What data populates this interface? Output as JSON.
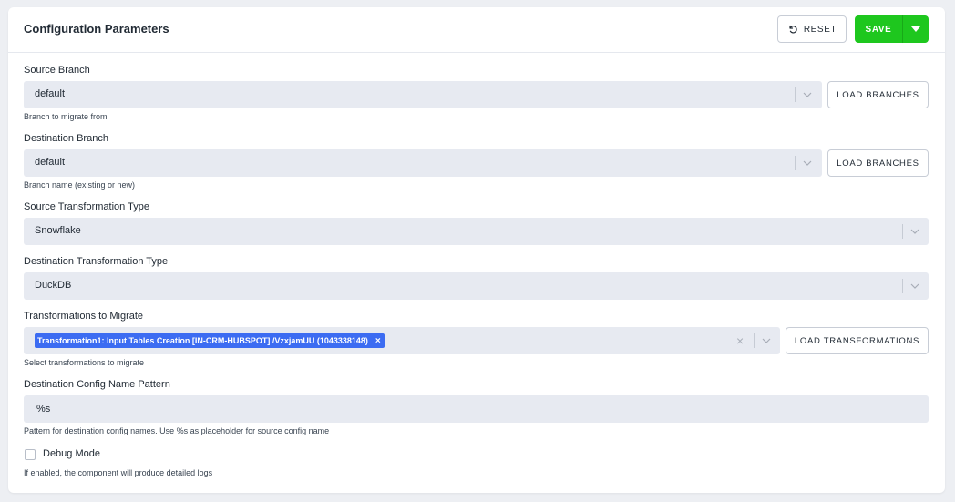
{
  "header": {
    "title": "Configuration Parameters",
    "reset_label": "RESET",
    "save_label": "SAVE"
  },
  "colors": {
    "save_green": "#1ec71e",
    "tag_blue": "#3c6cf2",
    "field_bg": "#e7eaf1"
  },
  "source_branch": {
    "label": "Source Branch",
    "value": "default",
    "button": "LOAD BRANCHES",
    "help": "Branch to migrate from"
  },
  "destination_branch": {
    "label": "Destination Branch",
    "value": "default",
    "button": "LOAD BRANCHES",
    "help": "Branch name (existing or new)"
  },
  "source_type": {
    "label": "Source Transformation Type",
    "value": "Snowflake"
  },
  "destination_type": {
    "label": "Destination Transformation Type",
    "value": "DuckDB"
  },
  "transformations": {
    "label": "Transformations to Migrate",
    "selected": [
      "Transformation1: Input Tables Creation [IN-CRM-HUBSPOT] /VzxjamUU (1043338148)"
    ],
    "button": "LOAD TRANSFORMATIONS",
    "help": "Select transformations to migrate"
  },
  "name_pattern": {
    "label": "Destination Config Name Pattern",
    "value": "%s",
    "help": "Pattern for destination config names. Use %s as placeholder for source config name"
  },
  "debug": {
    "label": "Debug Mode",
    "checked": false,
    "help": "If enabled, the component will produce detailed logs"
  }
}
